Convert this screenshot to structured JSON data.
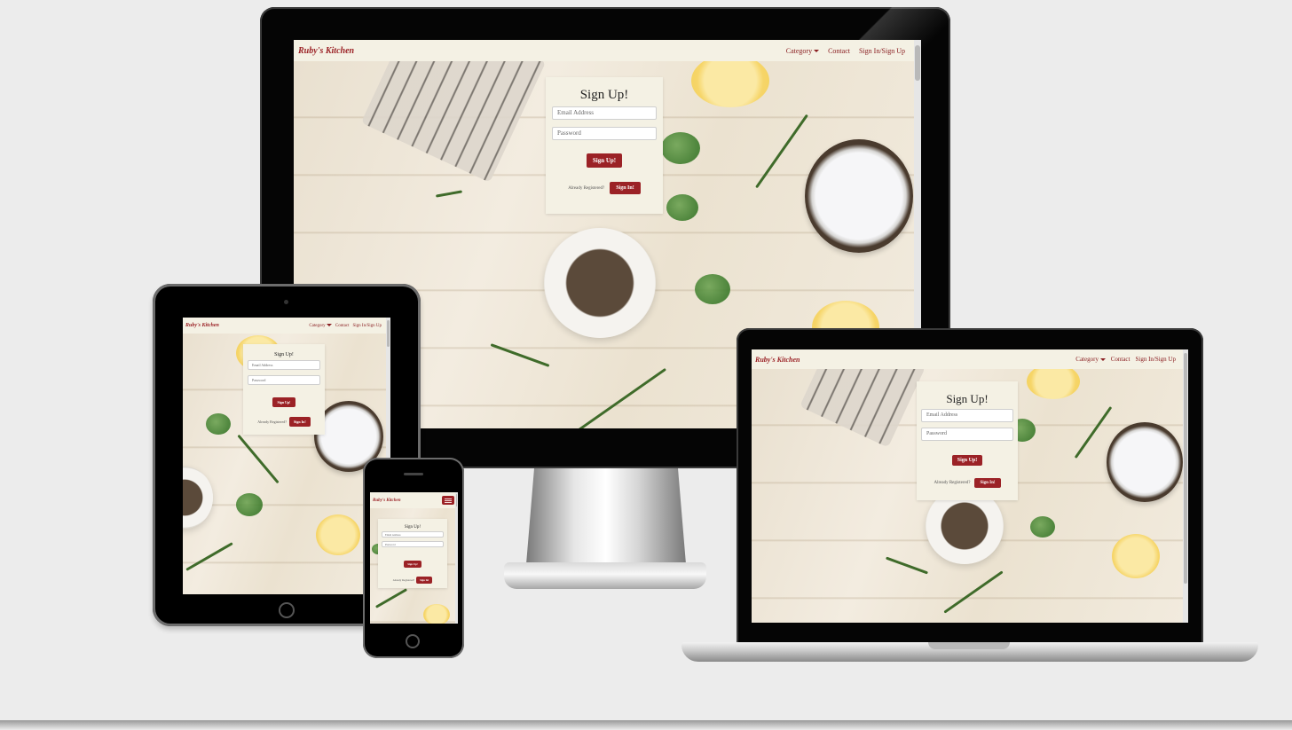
{
  "site": {
    "brand": "Ruby's Kitchen",
    "nav": {
      "category": "Category",
      "contact": "Contact",
      "signin_signup": "Sign In/Sign Up"
    },
    "form": {
      "title": "Sign Up!",
      "email_placeholder": "Email Address",
      "password_placeholder": "Password",
      "submit_label": "Sign Up!",
      "already_text": "Already Registered?",
      "signin_label": "Sign In!"
    }
  },
  "colors": {
    "accent": "#9b2226",
    "navbar_bg": "#f4f1e4",
    "background": "#ececec"
  },
  "icons": [
    "caret-down-icon",
    "hamburger-menu-icon"
  ],
  "devices": [
    "desktop-monitor",
    "laptop",
    "tablet",
    "phone"
  ]
}
